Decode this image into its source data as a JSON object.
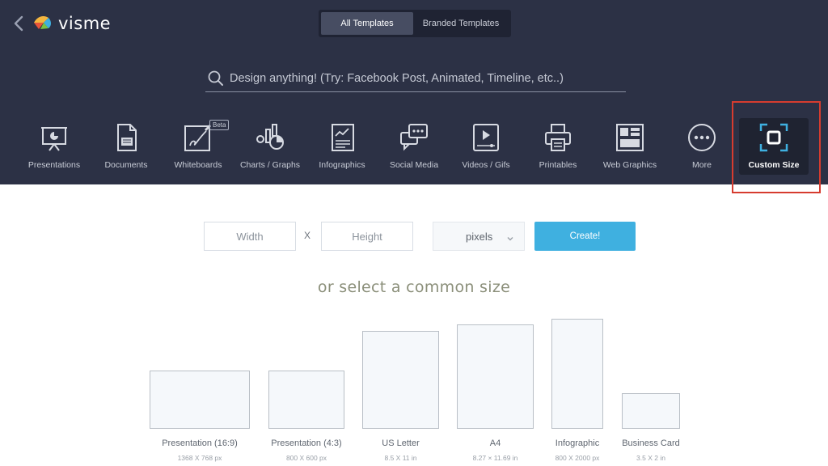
{
  "brand": {
    "name": "visme"
  },
  "template_tabs": [
    {
      "label": "All Templates",
      "active": true
    },
    {
      "label": "Branded Templates",
      "active": false
    }
  ],
  "search": {
    "placeholder": "Design anything! (Try: Facebook Post, Animated, Timeline, etc..)"
  },
  "categories": [
    {
      "label": "Presentations",
      "icon": "presentation-icon"
    },
    {
      "label": "Documents",
      "icon": "document-icon"
    },
    {
      "label": "Whiteboards",
      "icon": "whiteboard-icon",
      "badge": "Beta"
    },
    {
      "label": "Charts / Graphs",
      "icon": "chart-icon"
    },
    {
      "label": "Infographics",
      "icon": "infographic-icon"
    },
    {
      "label": "Social Media",
      "icon": "social-media-icon"
    },
    {
      "label": "Videos / Gifs",
      "icon": "video-icon"
    },
    {
      "label": "Printables",
      "icon": "printer-icon"
    },
    {
      "label": "Web Graphics",
      "icon": "web-graphics-icon"
    },
    {
      "label": "More",
      "icon": "more-icon"
    },
    {
      "label": "Custom Size",
      "icon": "custom-size-icon",
      "active": true
    }
  ],
  "custom_size": {
    "width_placeholder": "Width",
    "separator": "X",
    "height_placeholder": "Height",
    "unit": "pixels",
    "create_label": "Create!"
  },
  "common_sizes": {
    "heading": "or select a common size",
    "items": [
      {
        "name": "Presentation (16:9)",
        "dims": "1368 X 768 px"
      },
      {
        "name": "Presentation (4:3)",
        "dims": "800 X 600 px"
      },
      {
        "name": "US Letter",
        "dims": "8.5 X 11 in"
      },
      {
        "name": "A4",
        "dims": "8.27 × 11.69 in"
      },
      {
        "name": "Infographic",
        "dims": "800 X 2000 px"
      },
      {
        "name": "Business Card",
        "dims": "3.5 X 2 in"
      }
    ]
  },
  "colors": {
    "topbar": "#2c3145",
    "accent": "#3fb0e0",
    "highlight": "#d63c2f"
  }
}
